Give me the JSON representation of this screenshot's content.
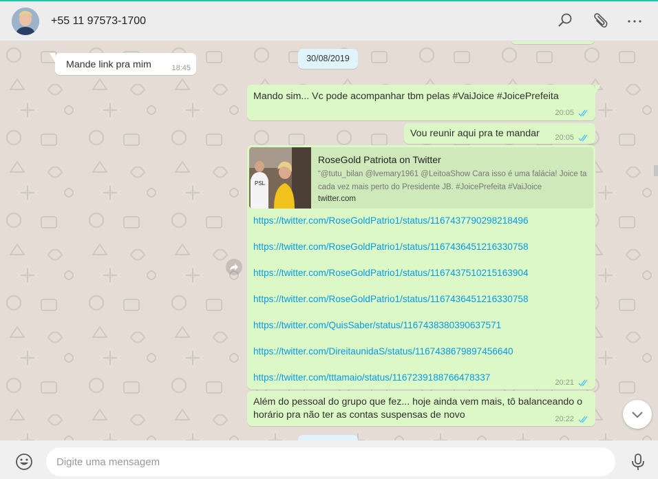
{
  "header": {
    "contact_name": "+55 11 97573-1700",
    "icons": [
      "search-icon",
      "attach-icon",
      "menu-icon"
    ]
  },
  "chat": {
    "date_chip": "30/08/2019",
    "messages": [
      {
        "direction": "in",
        "text": "Mande link pra mim",
        "time": "18:45"
      },
      {
        "direction": "out",
        "text": "Mando sim... Vc pode acompanhar tbm pelas #VaiJoice #JoicePrefeita",
        "time": "20:05",
        "status": "read"
      },
      {
        "direction": "out",
        "text": "Vou reunir aqui pra te mandar",
        "time": "20:05",
        "status": "read"
      },
      {
        "direction": "out",
        "time": "20:21",
        "status": "read",
        "preview": {
          "title": "RoseGold Patriota on Twitter",
          "description": "“@tutu_bilan @lvemary1961 @LeitoaShow Cara isso é uma falácia! Joice ta cada vez mais perto do Presidente JB. #JoicePrefeita #VaiJoice",
          "domain": "twitter.com"
        },
        "links": [
          "https://twitter.com/RoseGoldPatrio1/status/1167437790298218496",
          "https://twitter.com/RoseGoldPatrio1/status/1167436451216330758",
          "https://twitter.com/RoseGoldPatrio1/status/1167437510215163904",
          "https://twitter.com/RoseGoldPatrio1/status/1167436451216330758",
          "https://twitter.com/QuisSaber/status/1167438380390637571",
          "https://twitter.com/DireitaunidaS/status/1167438679897456640",
          "https://twitter.com/tttamaio/status/1167239188766478337"
        ]
      },
      {
        "direction": "out",
        "text": "Além do pessoal do grupo que fez... hoje ainda vem mais, tô balanceando o horário pra não ter as contas suspensas de novo",
        "time": "20:22",
        "status": "read"
      }
    ]
  },
  "footer": {
    "input_placeholder": "Digite uma mensagem"
  },
  "colors": {
    "accent_top": "#22c7a9",
    "outgoing_bubble": "#dcf8c6",
    "incoming_bubble": "#ffffff",
    "chat_background": "#e5ddd5",
    "link": "#039be5",
    "read_ticks": "#4fc3f7"
  }
}
